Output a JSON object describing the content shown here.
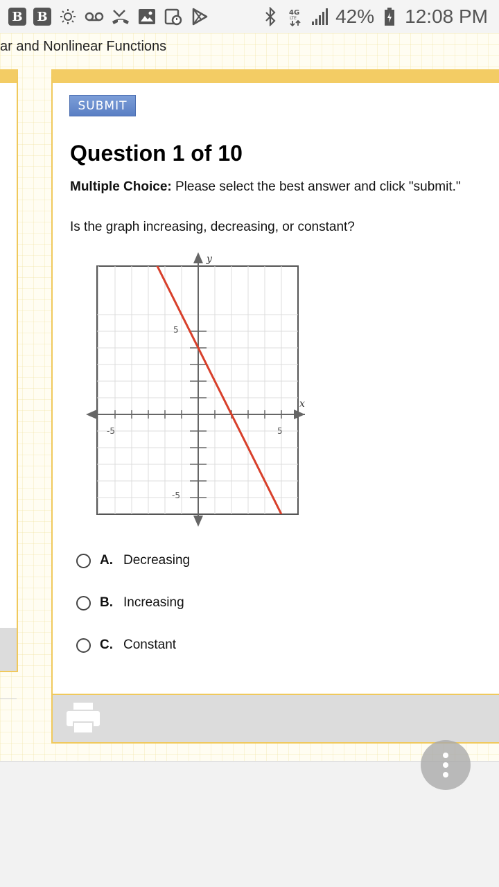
{
  "status_bar": {
    "badge1": "B",
    "badge2": "B",
    "battery": "42%",
    "time": "12:08 PM",
    "network": "4G LTE",
    "icons": [
      "sun-icon",
      "voicemail-icon",
      "missed-call-icon",
      "image-icon",
      "calendar-icon",
      "play-store-icon",
      "bluetooth-icon",
      "signal-icon",
      "battery-icon"
    ]
  },
  "breadcrumb": "ar and Nonlinear Functions",
  "submit_label": "SUBMIT",
  "question": {
    "title": "Question 1 of 10",
    "type_label": "Multiple Choice:",
    "instruction": " Please select the best answer and click \"submit.\"",
    "text": "Is the graph increasing, decreasing, or constant?"
  },
  "graph": {
    "x_label": "x",
    "y_label": "y",
    "tick_x_neg": "-5",
    "tick_x_pos": "5",
    "tick_y_pos": "5",
    "tick_y_neg": "-5",
    "line_color": "#d8402b",
    "line_points": [
      [
        -2.5,
        9
      ],
      [
        5,
        -6
      ]
    ]
  },
  "options": [
    {
      "letter": "A.",
      "label": "Decreasing"
    },
    {
      "letter": "B.",
      "label": "Increasing"
    },
    {
      "letter": "C.",
      "label": "Constant"
    }
  ],
  "colors": {
    "accent": "#f3cc64",
    "submit": "#5a7fc4"
  }
}
